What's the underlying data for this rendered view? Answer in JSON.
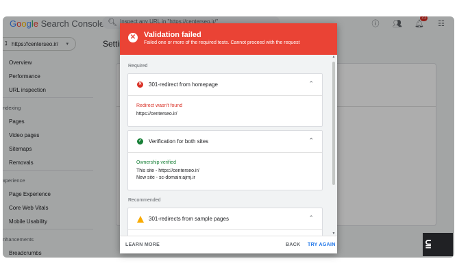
{
  "app": {
    "logo_text": "Google Search Console",
    "search_placeholder": "Inspect any URL in \"https://centerseo.ir/\"",
    "notification_count": "21"
  },
  "property": {
    "label": "https://centerseo.ir/"
  },
  "page_title": "Settin",
  "sidebar": {
    "items": [
      {
        "label": "Overview"
      },
      {
        "label": "Performance"
      },
      {
        "label": "URL inspection"
      }
    ],
    "sections": [
      {
        "title": "ndexing",
        "items": [
          "Pages",
          "Video pages",
          "Sitemaps",
          "Removals"
        ]
      },
      {
        "title": "xperience",
        "items": [
          "Page Experience",
          "Core Web Vitals",
          "Mobile Usability"
        ]
      },
      {
        "title": "nhancements",
        "items": [
          "Breadcrumbs"
        ]
      }
    ]
  },
  "dialog": {
    "title": "Validation failed",
    "subtitle": "Failed one or more of the required tests. Cannot proceed with the request",
    "required_label": "Required",
    "recommended_label": "Recommended",
    "checks": [
      {
        "title": "301-redirect from homepage",
        "status": "fail",
        "detail_status": "Redirect wasn't found",
        "detail_lines": [
          "https://centerseo.ir/"
        ]
      },
      {
        "title": "Verification for both sites",
        "status": "pass",
        "detail_status": "Ownership verified",
        "detail_lines": [
          "This site - https://centerseo.ir/",
          "New site - sc-domain:ajmj.ir"
        ]
      },
      {
        "title": "301-redirects from sample pages",
        "status": "warn"
      }
    ],
    "footer": {
      "learn_more": "LEARN MORE",
      "back": "BACK",
      "try_again": "TRY AGAIN"
    }
  },
  "colors": {
    "error": "#ea4335",
    "success": "#188038",
    "warning": "#f9ab00",
    "accent": "#1a73e8"
  }
}
